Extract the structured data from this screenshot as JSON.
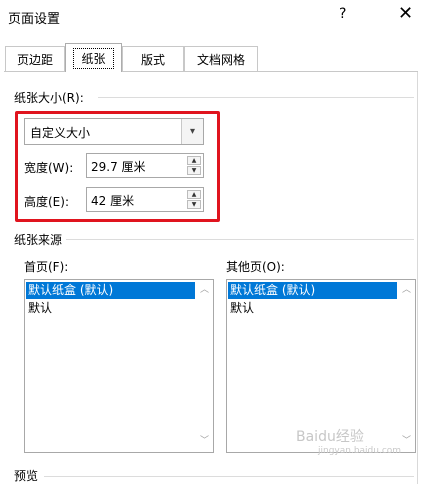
{
  "window": {
    "title": "页面设置",
    "help": "?",
    "close": "✕"
  },
  "tabs": [
    {
      "label": "页边距"
    },
    {
      "label": "纸张"
    },
    {
      "label": "版式"
    },
    {
      "label": "文档网格"
    }
  ],
  "paper_size": {
    "group_label": "纸张大小(R):",
    "selected": "自定义大小",
    "width_label": "宽度(W):",
    "width_value": "29.7 厘米",
    "height_label": "高度(E):",
    "height_value": "42 厘米"
  },
  "paper_source": {
    "group_label": "纸张来源",
    "first_page_label": "首页(F):",
    "other_pages_label": "其他页(O):",
    "first_page_items": [
      "默认纸盒 (默认)",
      "默认"
    ],
    "other_pages_items": [
      "默认纸盒 (默认)",
      "默认"
    ]
  },
  "preview": {
    "group_label": "预览"
  },
  "watermark": {
    "text": "Baidu经验",
    "sub": "jingyan.baidu.com"
  },
  "colors": {
    "highlight": "#e0141e",
    "selection": "#0078d7"
  }
}
